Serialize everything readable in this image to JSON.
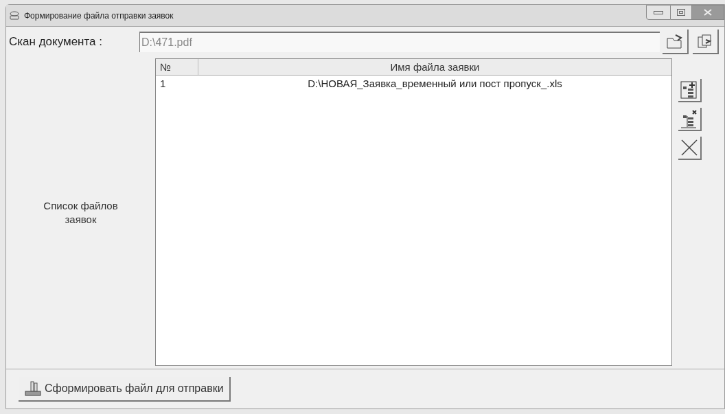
{
  "window": {
    "title": "Формирование файла отправки заявок"
  },
  "scan": {
    "label": "Скан документа :",
    "value": "D:\\471.pdf"
  },
  "list_label": "Список файлов заявок",
  "table": {
    "columns": [
      "№",
      "Имя файла заявки"
    ],
    "rows": [
      {
        "number": "1",
        "file": "D:\\НОВАЯ_Заявка_временный или пост пропуск_.xls"
      }
    ]
  },
  "side_tools": [
    {
      "kind": "add"
    },
    {
      "kind": "remove"
    },
    {
      "kind": "clear"
    }
  ],
  "submit_button": "Сформировать файл для отправки"
}
